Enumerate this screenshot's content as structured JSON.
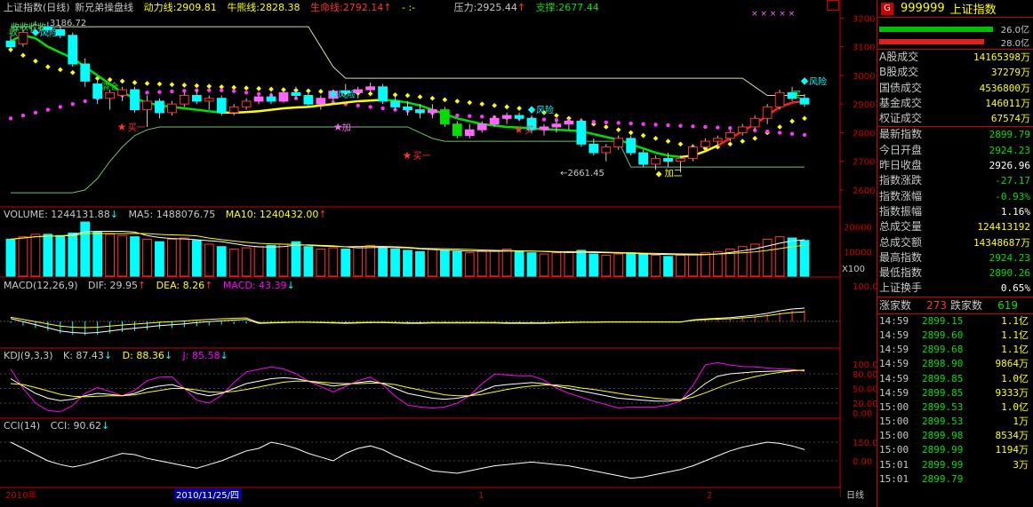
{
  "header": {
    "index_name": "上证指数(日线)",
    "indicator_name": "新兄弟操盘线",
    "dynamic_label": "动力线:",
    "dynamic_value": "2909.81",
    "bull_label": "牛熊线:",
    "bull_value": "2828.38",
    "life_label": "生命线:",
    "life_value": "2792.14",
    "arrow_up": "↑",
    "dash_sep": "- :-",
    "pressure_label": "压力:",
    "pressure_value": "2925.44",
    "pressure_arrow": "↑",
    "support_label": "支撑:",
    "support_value": "2677.44"
  },
  "volume_header": {
    "label": "VOLUME:",
    "value": "1244131.88",
    "arrow": "↓",
    "ma5_label": "MA5:",
    "ma5": "1488076.75",
    "ma10_label": "MA10:",
    "ma10": "1240432.00",
    "ma10_arrow": "↑"
  },
  "macd_header": {
    "label": "MACD(12,26,9)",
    "dif_label": "DIF:",
    "dif": "29.95",
    "dif_arrow": "↑",
    "dea_label": "DEA:",
    "dea": "8.26",
    "dea_arrow": "↑",
    "macd_label": "MACD:",
    "macd": "43.39",
    "macd_arrow": "↓"
  },
  "kdj_header": {
    "label": "KDJ(9,3,3)",
    "k_label": "K:",
    "k": "87.43",
    "k_arrow": "↓",
    "d_label": "D:",
    "d": "88.36",
    "d_arrow": "↓",
    "j_label": "J:",
    "j": "85.58",
    "j_arrow": "↓"
  },
  "cci_header": {
    "label": "CCI(14)",
    "cci_label": "CCI:",
    "cci": "90.62",
    "cci_arrow": "↓"
  },
  "price_axis": [
    "3200",
    "3100",
    "3000",
    "2900",
    "2800",
    "2700",
    "2600"
  ],
  "volume_axis": [
    "20000",
    "10000"
  ],
  "volume_unit": "X100",
  "macd_axis": [
    "100.0"
  ],
  "kdj_axis": [
    "100.00",
    "80.00",
    "50.00",
    "20.00",
    "0.00"
  ],
  "cci_axis": [
    "150.0",
    "0.00"
  ],
  "annotations": {
    "high_label": "3186.72",
    "low_label": "←2661.45",
    "risk1": "风险",
    "risk2": "风险",
    "risk3": "风险",
    "risk4": "风险",
    "clear": "清仓",
    "buy1": "买一",
    "buy2": "买一",
    "buy3": "买一",
    "add1": "加一",
    "add2": "加二",
    "add3": "加一",
    "shou": "收收收收",
    "shou2": "收",
    "mai": "买",
    "dots": "× × × × ×"
  },
  "date_axis": {
    "year": "2010年",
    "current": "2010/11/25/四",
    "m1": "1",
    "m2": "2",
    "period": "日线"
  },
  "right_panel": {
    "g_icon": "G",
    "code": "999999",
    "name": "上证指数",
    "bar1_label": "26.0亿",
    "bar2_label": "28.0亿",
    "stats_top": [
      {
        "k": "A股成交",
        "v": "14165398万",
        "c": "#ffff00"
      },
      {
        "k": "B股成交",
        "v": "37279万",
        "c": "#ffff00"
      },
      {
        "k": "国债成交",
        "v": "4536800万",
        "c": "#ffff00"
      },
      {
        "k": "基金成交",
        "v": "146011万",
        "c": "#ffff00"
      },
      {
        "k": "权证成交",
        "v": "67574万",
        "c": "#ffff00"
      }
    ],
    "stats_main": [
      {
        "k": "最新指数",
        "v": "2899.79",
        "c": "#00e000"
      },
      {
        "k": "今日开盘",
        "v": "2924.23",
        "c": "#00e000"
      },
      {
        "k": "昨日收盘",
        "v": "2926.96",
        "c": "#ffffff"
      },
      {
        "k": "指数涨跌",
        "v": "-27.17",
        "c": "#00e000"
      },
      {
        "k": "指数涨幅",
        "v": "-0.93%",
        "c": "#00e000"
      },
      {
        "k": "指数振幅",
        "v": "1.16%",
        "c": "#ffffff"
      },
      {
        "k": "总成交量",
        "v": "124413192",
        "c": "#ffff00"
      },
      {
        "k": "总成交额",
        "v": "14348687万",
        "c": "#ffff00"
      },
      {
        "k": "最高指数",
        "v": "2924.23",
        "c": "#00e000"
      },
      {
        "k": "最低指数",
        "v": "2890.26",
        "c": "#00e000"
      },
      {
        "k": "上证换手",
        "v": "0.65%",
        "c": "#ffffff"
      }
    ],
    "up_label": "涨家数",
    "up_count": "273",
    "down_label": "跌家数",
    "down_count": "619",
    "ticks": [
      {
        "t": "14:59",
        "p": "2899.15",
        "q": "1.1亿"
      },
      {
        "t": "14:59",
        "p": "2899.60",
        "q": "1.1亿"
      },
      {
        "t": "14:59",
        "p": "2899.68",
        "q": "1.1亿"
      },
      {
        "t": "14:59",
        "p": "2898.90",
        "q": "9864万"
      },
      {
        "t": "14:59",
        "p": "2899.85",
        "q": "1.0亿"
      },
      {
        "t": "14:59",
        "p": "2899.85",
        "q": "9333万"
      },
      {
        "t": "15:00",
        "p": "2899.53",
        "q": "1.0亿"
      },
      {
        "t": "15:00",
        "p": "2899.53",
        "q": "1万"
      },
      {
        "t": "15:00",
        "p": "2899.98",
        "q": "8534万"
      },
      {
        "t": "15:00",
        "p": "2899.99",
        "q": "1194万"
      },
      {
        "t": "15:01",
        "p": "2899.99",
        "q": "3万"
      },
      {
        "t": "15:01",
        "p": "2899.79",
        "q": ""
      }
    ]
  },
  "chart_data": {
    "type": "candlestick",
    "ylim": [
      2550,
      3220
    ],
    "candles": [
      [
        3120,
        3140,
        3080,
        3100
      ],
      [
        3110,
        3160,
        3100,
        3150
      ],
      [
        3150,
        3190,
        3140,
        3175
      ],
      [
        3170,
        3187,
        3150,
        3160
      ],
      [
        3160,
        3175,
        3130,
        3140
      ],
      [
        3140,
        3150,
        3030,
        3040
      ],
      [
        3040,
        3060,
        2960,
        2980
      ],
      [
        2970,
        2990,
        2900,
        2920
      ],
      [
        2920,
        2950,
        2880,
        2940
      ],
      [
        2930,
        2960,
        2910,
        2950
      ],
      [
        2950,
        2960,
        2870,
        2880
      ],
      [
        2880,
        2930,
        2820,
        2910
      ],
      [
        2910,
        2920,
        2850,
        2870
      ],
      [
        2870,
        2910,
        2860,
        2900
      ],
      [
        2900,
        2940,
        2890,
        2930
      ],
      [
        2930,
        2950,
        2900,
        2910
      ],
      [
        2910,
        2930,
        2880,
        2920
      ],
      [
        2920,
        2930,
        2860,
        2870
      ],
      [
        2870,
        2900,
        2860,
        2890
      ],
      [
        2890,
        2920,
        2880,
        2910
      ],
      [
        2910,
        2930,
        2900,
        2925
      ],
      [
        2925,
        2940,
        2900,
        2910
      ],
      [
        2910,
        2950,
        2905,
        2940
      ],
      [
        2940,
        2960,
        2920,
        2930
      ],
      [
        2930,
        2950,
        2890,
        2900
      ],
      [
        2900,
        2930,
        2880,
        2920
      ],
      [
        2920,
        2950,
        2910,
        2945
      ],
      [
        2945,
        2970,
        2930,
        2940
      ],
      [
        2940,
        2960,
        2920,
        2950
      ],
      [
        2950,
        2975,
        2940,
        2960
      ],
      [
        2960,
        2970,
        2900,
        2910
      ],
      [
        2910,
        2930,
        2880,
        2890
      ],
      [
        2890,
        2910,
        2860,
        2880
      ],
      [
        2880,
        2900,
        2850,
        2870
      ],
      [
        2870,
        2900,
        2850,
        2880
      ],
      [
        2880,
        2890,
        2820,
        2830
      ],
      [
        2830,
        2840,
        2780,
        2790
      ],
      [
        2790,
        2830,
        2780,
        2810
      ],
      [
        2810,
        2840,
        2800,
        2830
      ],
      [
        2830,
        2860,
        2820,
        2850
      ],
      [
        2850,
        2870,
        2830,
        2860
      ],
      [
        2860,
        2870,
        2840,
        2850
      ],
      [
        2850,
        2860,
        2800,
        2810
      ],
      [
        2810,
        2830,
        2790,
        2820
      ],
      [
        2820,
        2840,
        2800,
        2830
      ],
      [
        2830,
        2850,
        2810,
        2840
      ],
      [
        2840,
        2850,
        2750,
        2760
      ],
      [
        2760,
        2780,
        2720,
        2730
      ],
      [
        2730,
        2760,
        2700,
        2750
      ],
      [
        2750,
        2790,
        2740,
        2780
      ],
      [
        2780,
        2790,
        2720,
        2730
      ],
      [
        2730,
        2740,
        2680,
        2690
      ],
      [
        2690,
        2720,
        2670,
        2710
      ],
      [
        2710,
        2730,
        2680,
        2700
      ],
      [
        2700,
        2720,
        2661,
        2710
      ],
      [
        2710,
        2760,
        2700,
        2750
      ],
      [
        2750,
        2780,
        2740,
        2770
      ],
      [
        2770,
        2790,
        2750,
        2780
      ],
      [
        2780,
        2810,
        2770,
        2800
      ],
      [
        2800,
        2830,
        2790,
        2820
      ],
      [
        2820,
        2860,
        2810,
        2850
      ],
      [
        2850,
        2900,
        2830,
        2890
      ],
      [
        2890,
        2950,
        2880,
        2940
      ],
      [
        2940,
        2960,
        2910,
        2920
      ],
      [
        2920,
        2935,
        2890,
        2900
      ]
    ],
    "volume": [
      150,
      160,
      170,
      170,
      165,
      175,
      220,
      180,
      170,
      165,
      160,
      150,
      140,
      150,
      155,
      145,
      130,
      120,
      110,
      115,
      120,
      125,
      130,
      140,
      120,
      110,
      115,
      110,
      120,
      125,
      115,
      110,
      105,
      100,
      110,
      105,
      100,
      95,
      100,
      105,
      110,
      100,
      95,
      90,
      95,
      100,
      105,
      90,
      85,
      90,
      95,
      90,
      85,
      80,
      85,
      90,
      95,
      100,
      110,
      120,
      130,
      150,
      160,
      155,
      145
    ],
    "macd": [
      -5,
      -15,
      -25,
      -35,
      -45,
      -50,
      -52,
      -50,
      -45,
      -40,
      -36,
      -32,
      -28,
      -25,
      -22,
      -18,
      -15,
      -12,
      -10,
      -8,
      -6,
      -5,
      -4,
      -3,
      -3,
      -4,
      -5,
      -6,
      -5,
      -4,
      -4,
      -5,
      -6,
      -6,
      -5,
      -5,
      -5,
      -5,
      -5,
      -5,
      -6,
      -6,
      -6,
      -6,
      -5,
      -4,
      -3,
      -3,
      -2,
      -2,
      -2,
      -2,
      -2,
      -2,
      -2,
      5,
      8,
      10,
      12,
      16,
      20,
      26,
      34,
      40,
      43
    ],
    "kdj_k": [
      70,
      55,
      40,
      30,
      25,
      28,
      35,
      40,
      38,
      35,
      40,
      50,
      55,
      58,
      50,
      40,
      35,
      40,
      50,
      60,
      65,
      70,
      72,
      70,
      65,
      60,
      55,
      58,
      62,
      65,
      60,
      50,
      40,
      35,
      30,
      28,
      30,
      35,
      45,
      55,
      58,
      60,
      62,
      60,
      55,
      50,
      45,
      40,
      35,
      30,
      28,
      26,
      24,
      24,
      26,
      40,
      60,
      75,
      80,
      82,
      84,
      85,
      86,
      87,
      87
    ],
    "kdj_d": [
      60,
      58,
      52,
      45,
      38,
      34,
      33,
      34,
      35,
      35,
      37,
      42,
      46,
      50,
      50,
      47,
      43,
      42,
      44,
      48,
      53,
      58,
      63,
      65,
      65,
      63,
      61,
      60,
      60,
      61,
      61,
      58,
      52,
      47,
      42,
      37,
      35,
      35,
      38,
      43,
      48,
      52,
      55,
      57,
      57,
      55,
      51,
      48,
      44,
      40,
      36,
      33,
      30,
      28,
      27,
      32,
      41,
      51,
      61,
      68,
      74,
      79,
      83,
      86,
      88
    ],
    "kdj_j": [
      90,
      50,
      20,
      5,
      2,
      15,
      40,
      52,
      44,
      35,
      46,
      66,
      73,
      74,
      50,
      26,
      20,
      36,
      62,
      84,
      89,
      94,
      90,
      80,
      65,
      54,
      43,
      54,
      66,
      73,
      58,
      34,
      16,
      12,
      10,
      12,
      20,
      35,
      60,
      79,
      78,
      76,
      76,
      67,
      51,
      40,
      32,
      24,
      17,
      10,
      12,
      12,
      12,
      16,
      24,
      56,
      98,
      103,
      98,
      95,
      94,
      92,
      90,
      89,
      85
    ],
    "cci": [
      150,
      100,
      50,
      0,
      -30,
      -50,
      -30,
      0,
      30,
      60,
      50,
      20,
      0,
      -20,
      -40,
      -60,
      -30,
      0,
      40,
      80,
      100,
      150,
      130,
      100,
      60,
      30,
      0,
      60,
      100,
      120,
      90,
      40,
      0,
      -40,
      -80,
      -90,
      -100,
      -80,
      -60,
      -40,
      -30,
      -20,
      -10,
      -20,
      -30,
      -40,
      -60,
      -80,
      -100,
      -120,
      -140,
      -130,
      -110,
      -90,
      -70,
      -40,
      0,
      40,
      80,
      110,
      130,
      150,
      140,
      120,
      90
    ],
    "dyn_line": [
      3120,
      3140,
      3130,
      3100,
      3080,
      3060,
      3030,
      3000,
      2970,
      2940,
      2920,
      2905,
      2895,
      2890,
      2885,
      2880,
      2875,
      2870,
      2870,
      2872,
      2875,
      2880,
      2885,
      2888,
      2890,
      2895,
      2900,
      2905,
      2910,
      2912,
      2915,
      2912,
      2905,
      2895,
      2880,
      2865,
      2850,
      2840,
      2830,
      2825,
      2820,
      2818,
      2815,
      2812,
      2810,
      2808,
      2805,
      2795,
      2785,
      2775,
      2760,
      2745,
      2730,
      2720,
      2715,
      2720,
      2735,
      2755,
      2780,
      2805,
      2830,
      2860,
      2890,
      2905,
      2910
    ],
    "support_step": [
      2590,
      2590,
      2590,
      2590,
      2590,
      2590,
      2600,
      2640,
      2700,
      2750,
      2790,
      2810,
      2820,
      2820,
      2820,
      2820,
      2820,
      2820,
      2820,
      2820,
      2820,
      2820,
      2820,
      2820,
      2820,
      2820,
      2820,
      2820,
      2820,
      2820,
      2820,
      2820,
      2820,
      2800,
      2780,
      2770,
      2770,
      2770,
      2770,
      2770,
      2770,
      2770,
      2770,
      2770,
      2770,
      2770,
      2770,
      2770,
      2770,
      2770,
      2680,
      2680,
      2680,
      2680,
      2680,
      2680,
      2680,
      2680,
      2680,
      2680,
      2680,
      2680,
      2680,
      2680,
      2680
    ],
    "resist_step": [
      3170,
      3170,
      3170,
      3170,
      3170,
      3170,
      3170,
      3170,
      3170,
      3170,
      3170,
      3170,
      3170,
      3170,
      3170,
      3170,
      3170,
      3170,
      3170,
      3170,
      3170,
      3170,
      3170,
      3170,
      3170,
      3100,
      3030,
      2990,
      2990,
      2990,
      2990,
      2990,
      2990,
      2990,
      2990,
      2990,
      2990,
      2990,
      2990,
      2990,
      2990,
      2990,
      2990,
      2990,
      2990,
      2990,
      2990,
      2990,
      2990,
      2990,
      2990,
      2990,
      2990,
      2990,
      2990,
      2990,
      2990,
      2990,
      2990,
      2990,
      2960,
      2930,
      2930,
      2930,
      2930
    ],
    "dots_upper": [
      3090,
      3070,
      3050,
      3030,
      3020,
      3010,
      3000,
      2990,
      2985,
      2980,
      2975,
      2972,
      2970,
      2968,
      2966,
      2964,
      2962,
      2960,
      2958,
      2956,
      2954,
      2952,
      2950,
      2948,
      2946,
      2944,
      2942,
      2940,
      2938,
      2936,
      2934,
      2932,
      2930,
      2925,
      2920,
      2915,
      2910,
      2905,
      2900,
      2895,
      2890,
      2885,
      2880,
      2870,
      2860,
      2850,
      2840,
      2830,
      2820,
      2810,
      2800,
      2790,
      2780,
      2770,
      2760,
      2750,
      2745,
      2750,
      2760,
      2770,
      2780,
      2800,
      2820,
      2840,
      2850
    ],
    "dots_lower": [
      2850,
      2860,
      2870,
      2880,
      2890,
      2900,
      2910,
      2920,
      2925,
      2930,
      2935,
      2940,
      2942,
      2944,
      2946,
      2948,
      2948,
      2948,
      2945,
      2940,
      2935,
      2930,
      2925,
      2920,
      2915,
      2910,
      2905,
      2900,
      2895,
      2890,
      2885,
      2880,
      2876,
      2872,
      2868,
      2864,
      2860,
      2858,
      2856,
      2854,
      2852,
      2850,
      2848,
      2846,
      2844,
      2842,
      2840,
      2838,
      2836,
      2834,
      2832,
      2830,
      2828,
      2826,
      2824,
      2822,
      2820,
      2818,
      2816,
      2812,
      2808,
      2804,
      2800,
      2796,
      2792
    ]
  }
}
